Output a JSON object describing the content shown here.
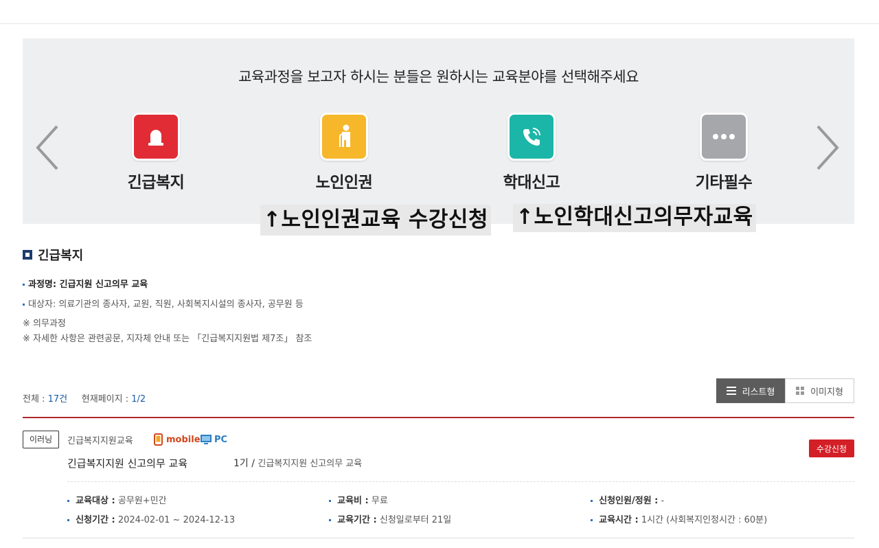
{
  "banner": {
    "title": "교육과정을 보고자 하시는 분들은 원하시는 교육분야를 선택해주세요",
    "categories": [
      {
        "label": "긴급복지",
        "icon": "alarm-bell-icon",
        "color": "#e12c36"
      },
      {
        "label": "노인인권",
        "icon": "elderly-person-icon",
        "color": "#f6b82a"
      },
      {
        "label": "학대신고",
        "icon": "phone-call-icon",
        "color": "#1bb6a8"
      },
      {
        "label": "기타필수",
        "icon": "more-dots-icon",
        "color": "#a5a7ab"
      }
    ],
    "callouts": [
      "↑노인인권교육 수강신청",
      "↑노인학대신고의무자교육"
    ]
  },
  "section": {
    "title": "긴급복지",
    "course_line": "과정명: 긴급지원 신고의무 교육",
    "target_line": "대상자: 의료기관의 종사자, 교원, 직원, 사회복지시설의 종사자, 공무원 등",
    "note1": "※ 의무과정",
    "note2": "※ 자세한 사항은 관련공문, 지자체 안내 또는 「긴급복지지원법 제7조」 참조"
  },
  "listing": {
    "total_label": "전체 :",
    "total_value": "17건",
    "page_label": "현재페이지 :",
    "page_value": "1/2",
    "view_list": "리스트형",
    "view_image": "이미지형"
  },
  "course": {
    "type_badge": "이러닝",
    "category": "긴급복지지원교육",
    "mobile_label": "mobile",
    "pc_label": "PC",
    "title": "긴급복지지원 신고의무 교육",
    "term": "1기 /",
    "term_title": "긴급복지지원 신고의무 교육",
    "enroll_label": "수강신청",
    "details": {
      "target_label": "교육대상 :",
      "target_value": "공무원+민간",
      "fee_label": "교육비 :",
      "fee_value": "무료",
      "capacity_label": "신청인원/정원 :",
      "capacity_value": "-",
      "apply_label": "신청기간 :",
      "apply_value": "2024-02-01 ~ 2024-12-13",
      "period_label": "교육기간 :",
      "period_value": "신청일로부터 21일",
      "hours_label": "교육시간 :",
      "hours_value": "1시간 (사회복지인정시간 : 60분)"
    }
  }
}
